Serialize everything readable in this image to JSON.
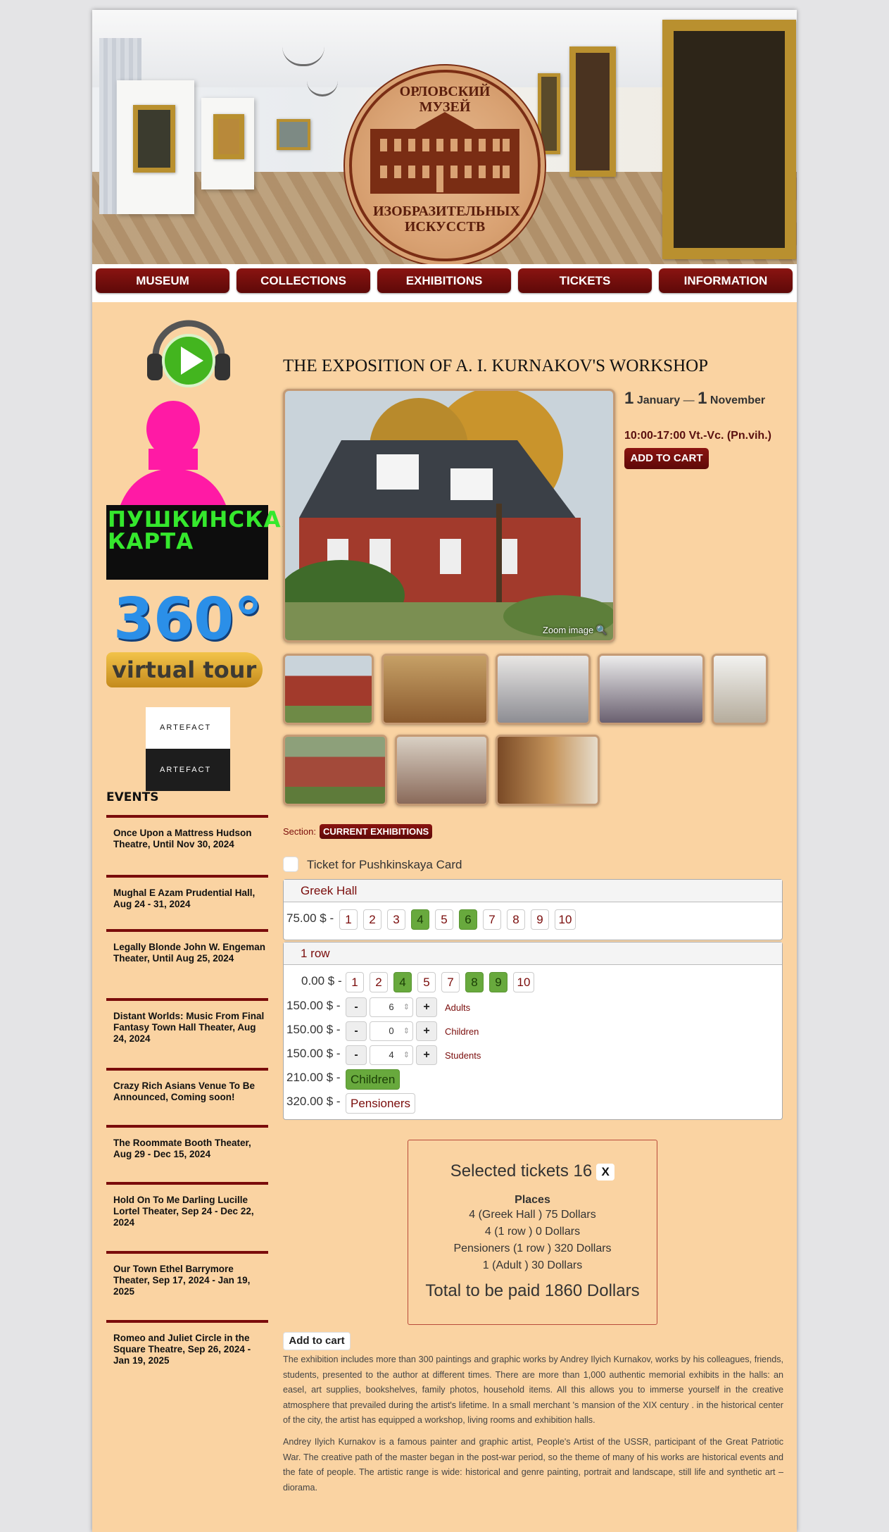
{
  "header": {
    "logo_top": "ОРЛОВСКИЙ МУЗЕЙ",
    "logo_bottom": "ИЗОБРАЗИТЕЛЬНЫХ ИСКУССТВ"
  },
  "nav": {
    "items": [
      "MUSEUM",
      "COLLECTIONS",
      "EXHIBITIONS",
      "TICKETS",
      "INFORMATION"
    ]
  },
  "sidebar": {
    "audio_guide_icon": "headphones-play-icon",
    "pushkin_card": "ПУШКИНСКАЯ КАРТА",
    "tour_360": "360°",
    "tour_label": "virtual tour",
    "artefact_1": "ARTEFACT",
    "artefact_2": "ARTEFACT",
    "events_title": "EVENTS",
    "events": [
      "Once Upon a Mattress Hudson Theatre, Until Nov 30, 2024",
      "Mughal E Azam Prudential Hall, Aug 24 - 31, 2024",
      "Legally Blonde John W. Engeman Theater, Until Aug 25, 2024",
      "Distant Worlds: Music From Final Fantasy Town Hall Theater, Aug 24, 2024",
      "Crazy Rich Asians Venue To Be Announced, Coming soon!",
      "The Roommate Booth Theater, Aug 29 - Dec 15, 2024",
      "Hold On To Me Darling Lucille Lortel Theater, Sep 24 - Dec 22, 2024",
      "Our Town Ethel Barrymore Theater, Sep 17, 2024 - Jan 19, 2025",
      "Romeo and Juliet Circle in the Square Theatre, Sep 26, 2024 - Jan 19, 2025"
    ]
  },
  "exhibition": {
    "title": "THE EXPOSITION OF A. I. KURNAKOV'S WORKSHOP",
    "zoom_label": "Zoom image",
    "date_day_start": "1",
    "date_month_start": "January",
    "date_sep": "—",
    "date_day_end": "1",
    "date_month_end": "November",
    "hours": "10:00-17:00 Vt.-Vc. (Pn.vih.)",
    "add_to_cart": "ADD TO CART",
    "section_label": "Section:",
    "section_value": "CURRENT EXHIBITIONS",
    "pushkin_ticket_label": "Ticket for Pushkinskaya Card"
  },
  "greek_hall": {
    "name": "Greek Hall",
    "price": "75.00 $ -",
    "seats": [
      "1",
      "2",
      "3",
      "4",
      "5",
      "6",
      "7",
      "8",
      "9",
      "10"
    ],
    "selected": [
      false,
      false,
      false,
      true,
      false,
      true,
      false,
      false,
      false,
      false
    ]
  },
  "row1": {
    "name": "1 row",
    "price": "0.00 $ -",
    "seats": [
      "1",
      "2",
      "4",
      "5",
      "7",
      "8",
      "9",
      "10"
    ],
    "selected": [
      false,
      false,
      true,
      false,
      false,
      true,
      true,
      false
    ],
    "categories": [
      {
        "price": "150.00 $ -",
        "minus": "-",
        "value": "6",
        "plus": "+",
        "label": "Adults"
      },
      {
        "price": "150.00 $ -",
        "minus": "-",
        "value": "0",
        "plus": "+",
        "label": "Children"
      },
      {
        "price": "150.00 $ -",
        "minus": "-",
        "value": "4",
        "plus": "+",
        "label": "Students"
      }
    ],
    "extra": [
      {
        "price": "210.00 $ -",
        "label": "Children",
        "selected": true
      },
      {
        "price": "320.00 $ -",
        "label": "Pensioners",
        "selected": false
      }
    ]
  },
  "summary": {
    "title": "Selected tickets 16",
    "close": "X",
    "places_label": "Places",
    "lines": [
      "4 (Greek Hall ) 75 Dollars",
      "4 (1 row ) 0 Dollars",
      "Pensioners (1 row ) 320 Dollars",
      "1 (Adult ) 30 Dollars"
    ],
    "total": "Total to be paid 1860 Dollars"
  },
  "cart_button": "Add to cart",
  "description": [
    "The exhibition includes more than 300 paintings and graphic works by Andrey Ilyich Kurnakov, works by his colleagues, friends, students, presented to the author at different times. There are more than 1,000 authentic memorial exhibits in the halls: an easel, art supplies, bookshelves, family photos, household items. All this allows you to immerse yourself in the creative atmosphere that prevailed during the artist's lifetime. In a small merchant 's mansion of the XIX century . in the historical center of the city, the artist has equipped a workshop, living rooms and exhibition halls.",
    "Andrey Ilyich Kurnakov is a famous painter and graphic artist, People's Artist of the USSR, participant of the Great Patriotic War. The creative path of the master began in the post-war period, so the theme of many of his works are historical events and the fate of people. The artistic range is wide: historical and genre painting, portrait and landscape, still life and synthetic art – diorama."
  ],
  "colors": {
    "page_bg": "#fad3a2",
    "accent": "#7a0c0b",
    "selected_seat": "#68a93d"
  }
}
